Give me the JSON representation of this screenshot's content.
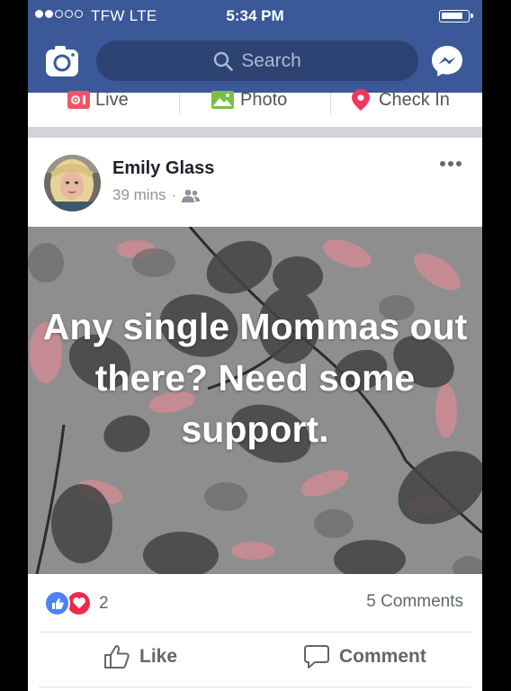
{
  "status_bar": {
    "carrier": "TFW  LTE",
    "time": "5:34 PM"
  },
  "header": {
    "search_placeholder": "Search",
    "camera_icon": "camera-icon",
    "messenger_icon": "messenger-icon",
    "brand_color": "#3b5998"
  },
  "composer": {
    "items": [
      {
        "label": "Live",
        "icon": "live-video-icon"
      },
      {
        "label": "Photo",
        "icon": "photo-icon"
      },
      {
        "label": "Check In",
        "icon": "location-pin-icon"
      }
    ]
  },
  "post": {
    "author": "Emily Glass",
    "time_ago": "39 mins",
    "separator": "·",
    "privacy_icon": "friends-icon",
    "image_text": "Any single Mommas out there? Need some support.",
    "reaction_count": "2",
    "comments_label": "5 Comments",
    "actions": {
      "like_label": "Like",
      "comment_label": "Comment"
    }
  }
}
